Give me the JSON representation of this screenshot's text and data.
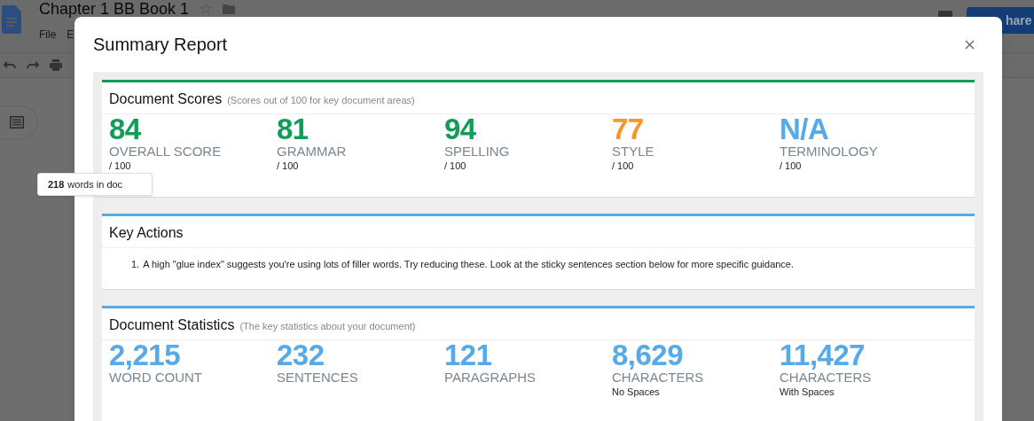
{
  "background_app": {
    "doc_title": "Chapter 1 BB Book 1",
    "menu": [
      "File",
      "E"
    ],
    "share_button": "hare"
  },
  "tooltip": {
    "count": "218",
    "text": "words in doc"
  },
  "dialog": {
    "title": "Summary Report",
    "sections": [
      {
        "kind": "scores",
        "title": "Document Scores",
        "subtitle": "(Scores out of 100 for key document areas)",
        "color": "#0f9d58",
        "items": [
          {
            "value": "84",
            "label": "OVERALL SCORE",
            "note": "/ 100",
            "color": "#0f9d58"
          },
          {
            "value": "81",
            "label": "GRAMMAR",
            "note": "/ 100",
            "color": "#0f9d58"
          },
          {
            "value": "94",
            "label": "SPELLING",
            "note": "/ 100",
            "color": "#0f9d58"
          },
          {
            "value": "77",
            "label": "STYLE",
            "note": "/ 100",
            "color": "#f7962b"
          },
          {
            "value": "N/A",
            "label": "TERMINOLOGY",
            "note": "/ 100",
            "color": "#58a9e8"
          }
        ]
      },
      {
        "kind": "list",
        "title": "Key Actions",
        "color": "#58a9e8",
        "items": [
          {
            "number": "1.",
            "text": "A high \"glue index\" suggests you're using lots of filler words. Try reducing these. Look at the sticky sentences section below for more specific guidance."
          }
        ]
      },
      {
        "kind": "scores",
        "title": "Document Statistics",
        "subtitle": "(The key statistics about your document)",
        "color": "#58a9e8",
        "items": [
          {
            "value": "2,215",
            "label": "WORD COUNT",
            "color": "#58a9e8"
          },
          {
            "value": "232",
            "label": "SENTENCES",
            "color": "#58a9e8"
          },
          {
            "value": "121",
            "label": "PARAGRAPHS",
            "color": "#58a9e8"
          },
          {
            "value": "8,629",
            "label": "CHARACTERS",
            "note": "No Spaces",
            "color": "#58a9e8"
          },
          {
            "value": "11,427",
            "label": "CHARACTERS",
            "note": "With Spaces",
            "color": "#58a9e8"
          }
        ]
      }
    ]
  }
}
